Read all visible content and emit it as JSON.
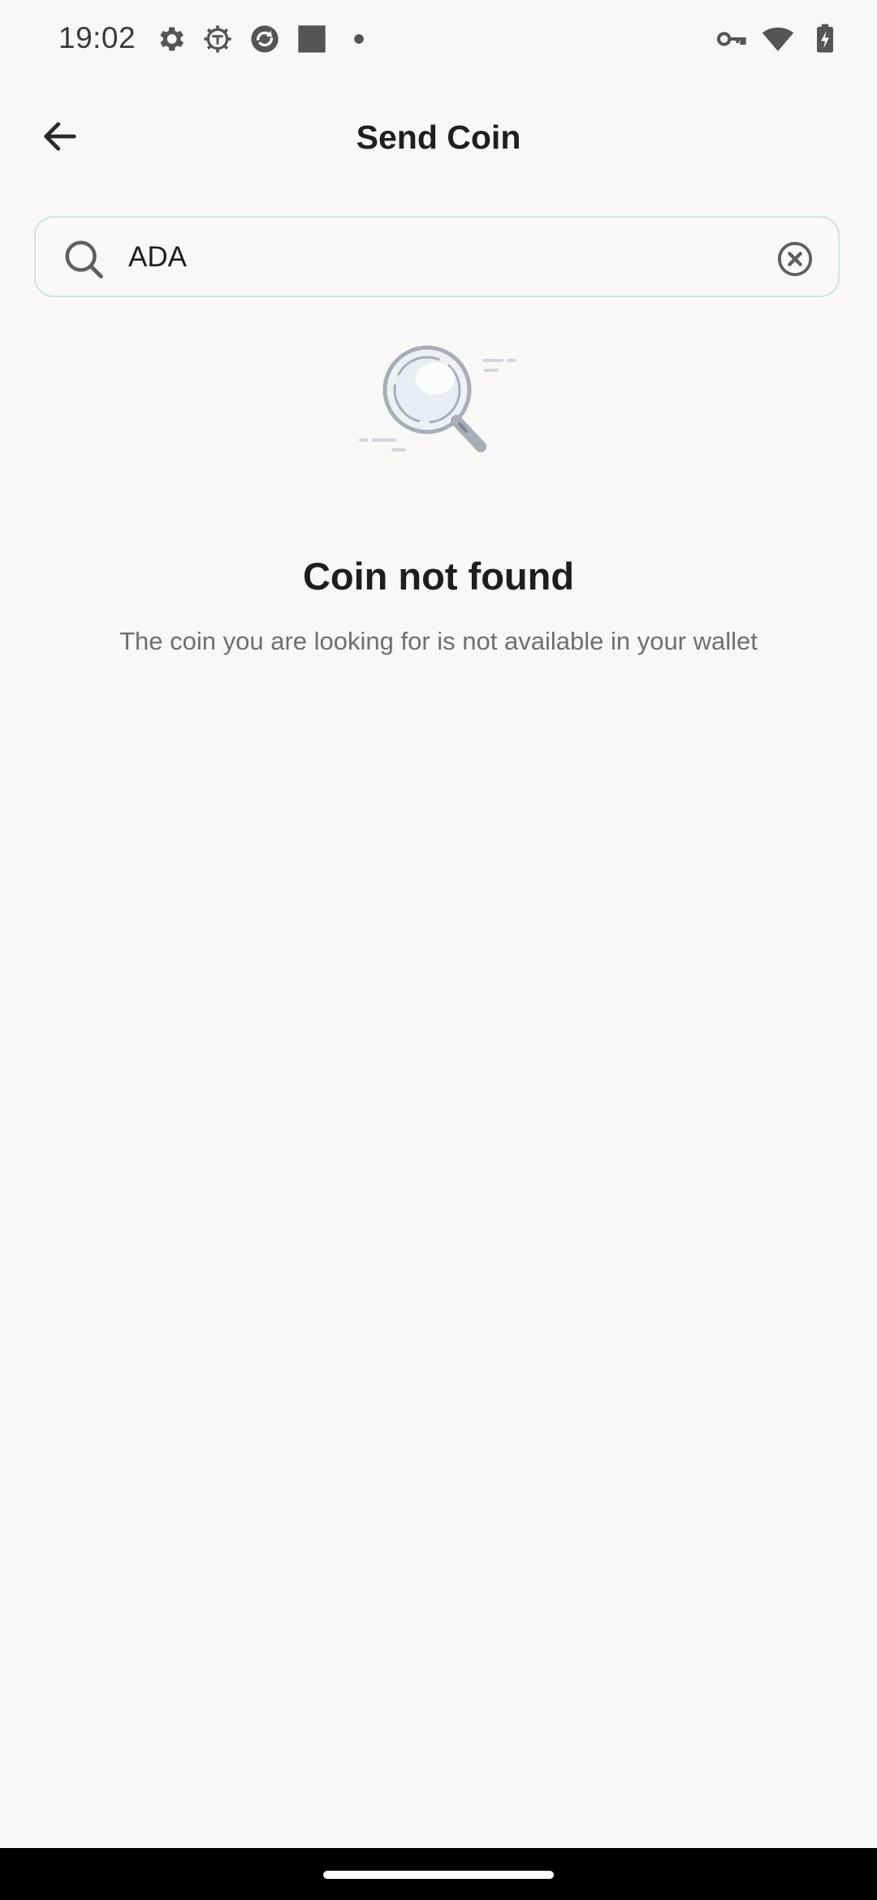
{
  "status_bar": {
    "time": "19:02",
    "left_icons": [
      "settings-gear-icon",
      "system-gear-icon",
      "sync-app-icon",
      "square-app-icon",
      "notification-dot-icon"
    ],
    "right_icons": [
      "vpn-key-icon",
      "wifi-icon",
      "battery-charging-icon"
    ]
  },
  "header": {
    "title": "Send Coin",
    "back_icon": "arrow-left-icon"
  },
  "search": {
    "value": "ADA",
    "placeholder": "",
    "icon": "search-icon",
    "clear_icon": "clear-circle-icon"
  },
  "empty_state": {
    "illustration": "magnifier-illustration",
    "title": "Coin not found",
    "message": "The coin you are looking for is not available in your wallet"
  },
  "colors": {
    "background": "#f9f8f6",
    "search_border": "#cfe6e3",
    "title_text": "#1e1e1e",
    "secondary_text": "#6f6f6f",
    "nav_bar": "#000000"
  }
}
